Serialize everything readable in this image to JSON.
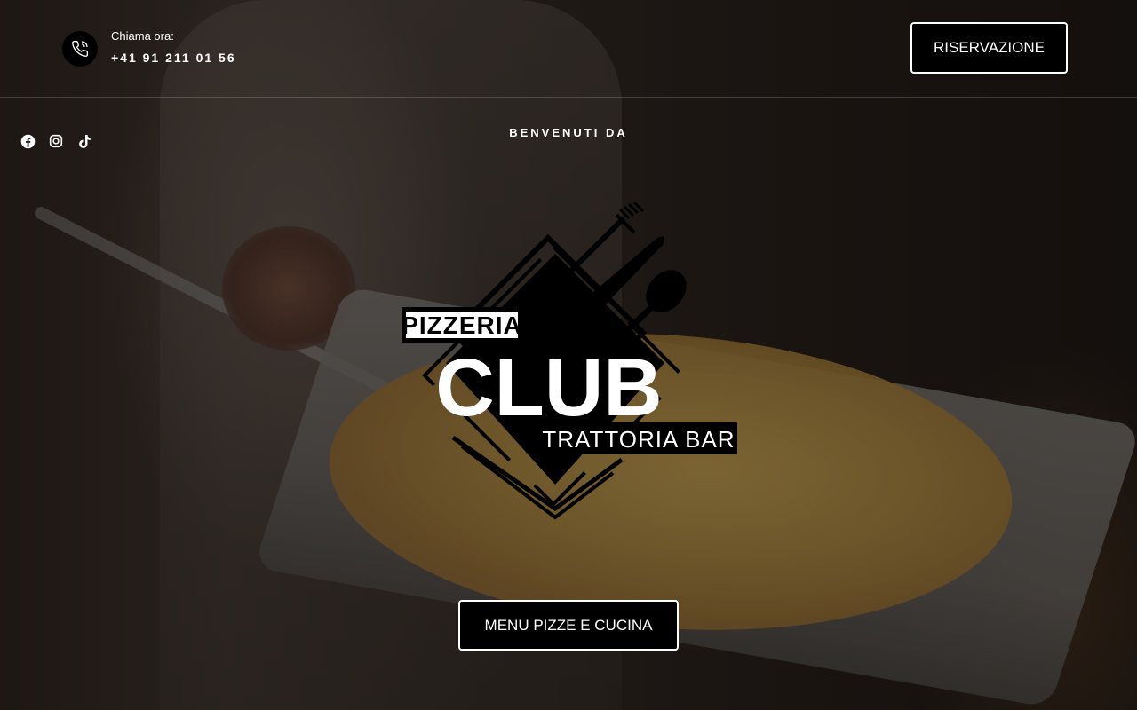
{
  "header": {
    "call_label": "Chiama ora:",
    "phone_number": "+41 91 211 01 56",
    "phone_icon": "phone-icon",
    "reserve_label": "RISERVAZIONE"
  },
  "social": [
    {
      "name": "facebook-icon"
    },
    {
      "name": "instagram-icon"
    },
    {
      "name": "tiktok-icon"
    }
  ],
  "hero": {
    "welcome": "BENVENUTI DA",
    "logo": {
      "top_word": "PIZZERIA",
      "main_word": "CLUB",
      "bottom_word": "TRATTORIA BAR"
    },
    "menu_button_label": "MENU PIZZE E CUCINA"
  },
  "colors": {
    "button_bg": "#000000",
    "button_border": "#ffffff",
    "text": "#ffffff"
  }
}
